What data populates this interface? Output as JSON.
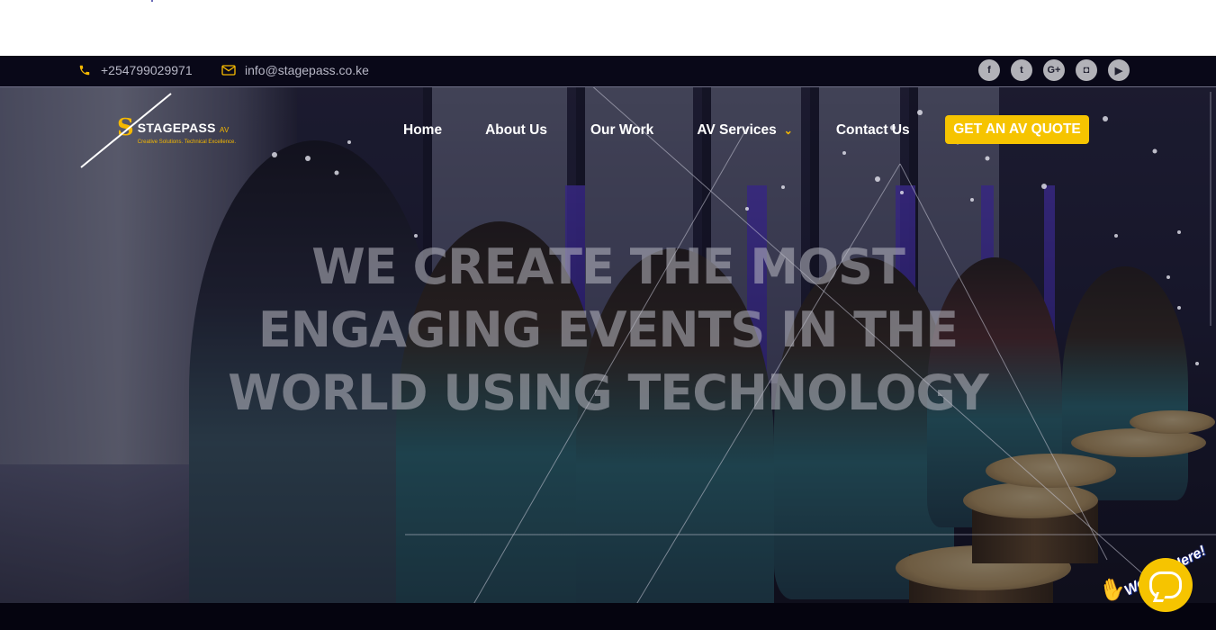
{
  "topbar": {
    "phone": "+254799029971",
    "email": "info@stagepass.co.ke",
    "social": [
      {
        "icon": "facebook-icon",
        "glyph": "f"
      },
      {
        "icon": "twitter-icon",
        "glyph": "t"
      },
      {
        "icon": "google-plus-icon",
        "glyph": "G+"
      },
      {
        "icon": "instagram-icon",
        "glyph": "◘"
      },
      {
        "icon": "youtube-icon",
        "glyph": "▶"
      }
    ]
  },
  "logo": {
    "mark": "S",
    "name": "STAGEPASS",
    "suffix": "AV",
    "tagline": "Creative Solutions. Technical Excellence."
  },
  "nav": {
    "items": [
      "Home",
      "About Us",
      "Our Work",
      "AV Services",
      "Contact Us"
    ],
    "quote_button": "GET AN AV QUOTE"
  },
  "hero": {
    "lines": [
      "WE CREATE THE MOST",
      "ENGAGING EVENTS IN THE",
      "WORLD USING TECHNOLOGY"
    ]
  },
  "chat": {
    "badge": "We Are Here!"
  },
  "colors": {
    "accent": "#f6c400",
    "topbar_bg": "#090818",
    "nav_text": "#ffffff"
  }
}
